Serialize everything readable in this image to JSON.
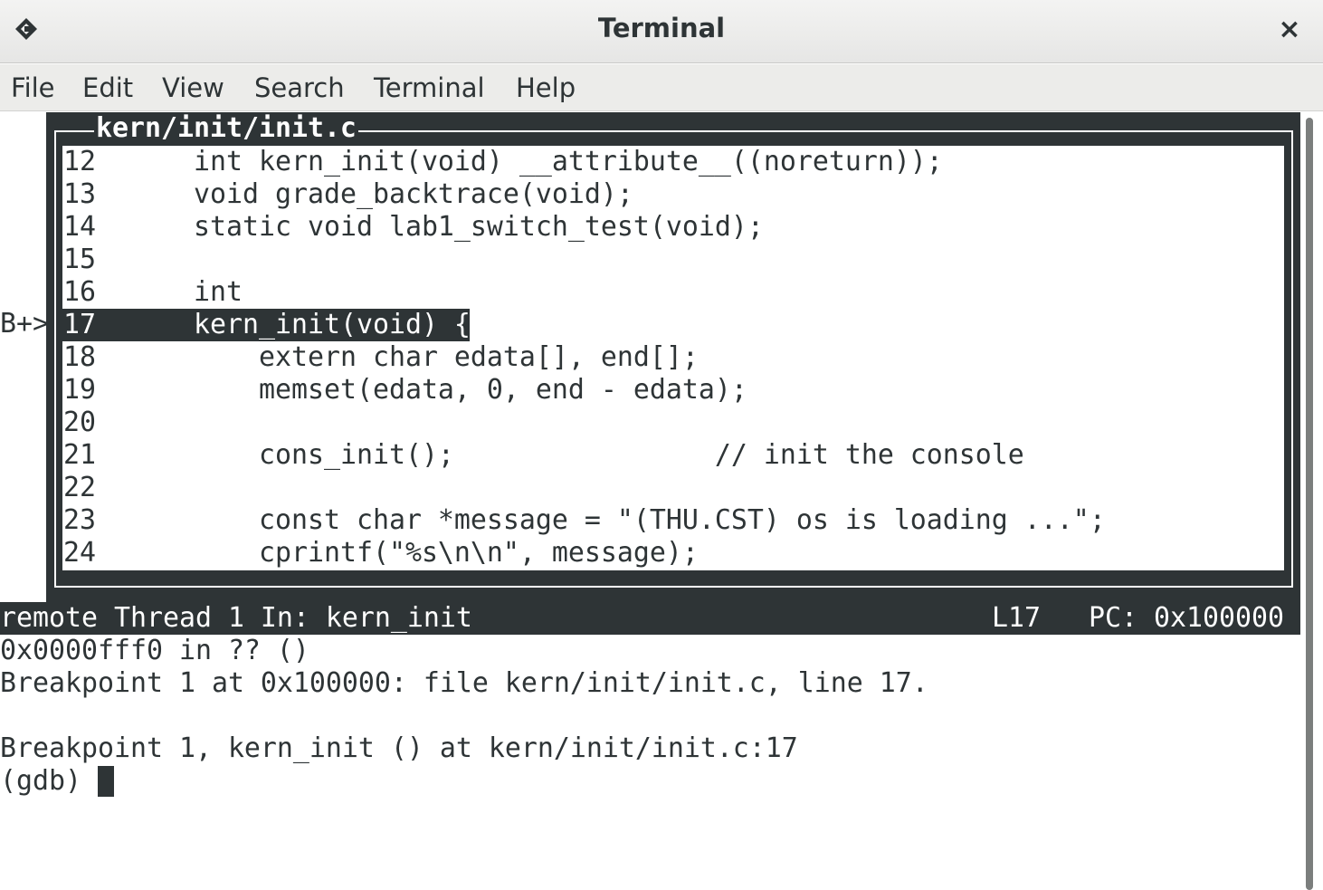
{
  "window": {
    "title": "Terminal",
    "app_icon": "terminal-app-icon",
    "close_icon": "close-icon",
    "close_glyph": "×"
  },
  "menu": {
    "items": [
      "File",
      "Edit",
      "View",
      "Search",
      "Terminal",
      "Help"
    ]
  },
  "source_window": {
    "title": "kern/init/init.c",
    "breakpoint_marker": "B+>",
    "current_line": 17,
    "lines": [
      {
        "num": "12",
        "code": "int kern_init(void) __attribute__((noreturn));"
      },
      {
        "num": "13",
        "code": "void grade_backtrace(void);"
      },
      {
        "num": "14",
        "code": "static void lab1_switch_test(void);"
      },
      {
        "num": "15",
        "code": ""
      },
      {
        "num": "16",
        "code": "int"
      },
      {
        "num": "17",
        "code": "kern_init(void) {"
      },
      {
        "num": "18",
        "code": "    extern char edata[], end[];"
      },
      {
        "num": "19",
        "code": "    memset(edata, 0, end - edata);"
      },
      {
        "num": "20",
        "code": ""
      },
      {
        "num": "21",
        "code": "    cons_init();                // init the console"
      },
      {
        "num": "22",
        "code": ""
      },
      {
        "num": "23",
        "code": "    const char *message = \"(THU.CST) os is loading ...\";"
      },
      {
        "num": "24",
        "code": "    cprintf(\"%s\\n\\n\", message);"
      }
    ]
  },
  "status_line": {
    "left": "remote Thread 1 In: kern_init",
    "line": "L17",
    "pc": "PC: 0x100000"
  },
  "console": {
    "lines": [
      "0x0000fff0 in ?? ()",
      "Breakpoint 1 at 0x100000: file kern/init/init.c, line 17.",
      "",
      "Breakpoint 1, kern_init () at kern/init/init.c:17"
    ],
    "prompt": "(gdb) "
  },
  "colors": {
    "foreground": "#2e3436",
    "background": "#ffffff",
    "highlight": "#2e3436"
  }
}
